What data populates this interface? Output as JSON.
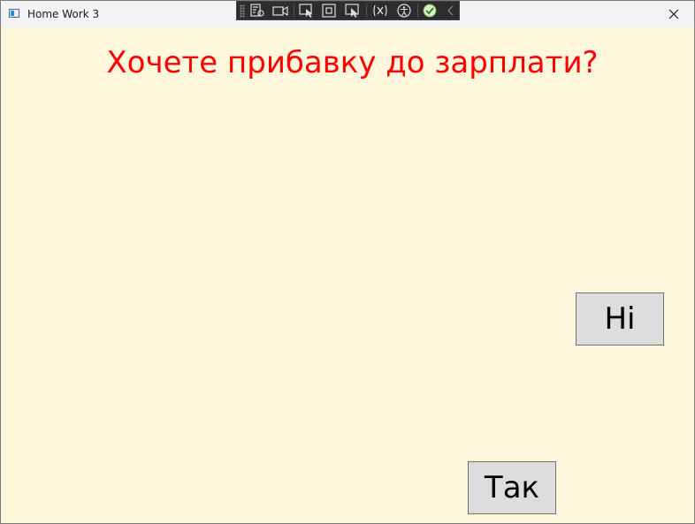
{
  "window": {
    "title": "Home Work 3",
    "background": "#fff8dc"
  },
  "debug_toolbar": {
    "icons": [
      "visual-tree-icon",
      "record-icon",
      "select-element-icon",
      "display-layout-adorners-icon",
      "track-focused-element-icon",
      "binding-failures-icon",
      "accessibility-checker-icon",
      "hot-reload-status-icon",
      "collapse-chevron-icon"
    ]
  },
  "content": {
    "question": "Хочете прибавку до зарплати?",
    "question_color": "#ff0000",
    "no_button_label": "Ні",
    "yes_button_label": "Так"
  }
}
